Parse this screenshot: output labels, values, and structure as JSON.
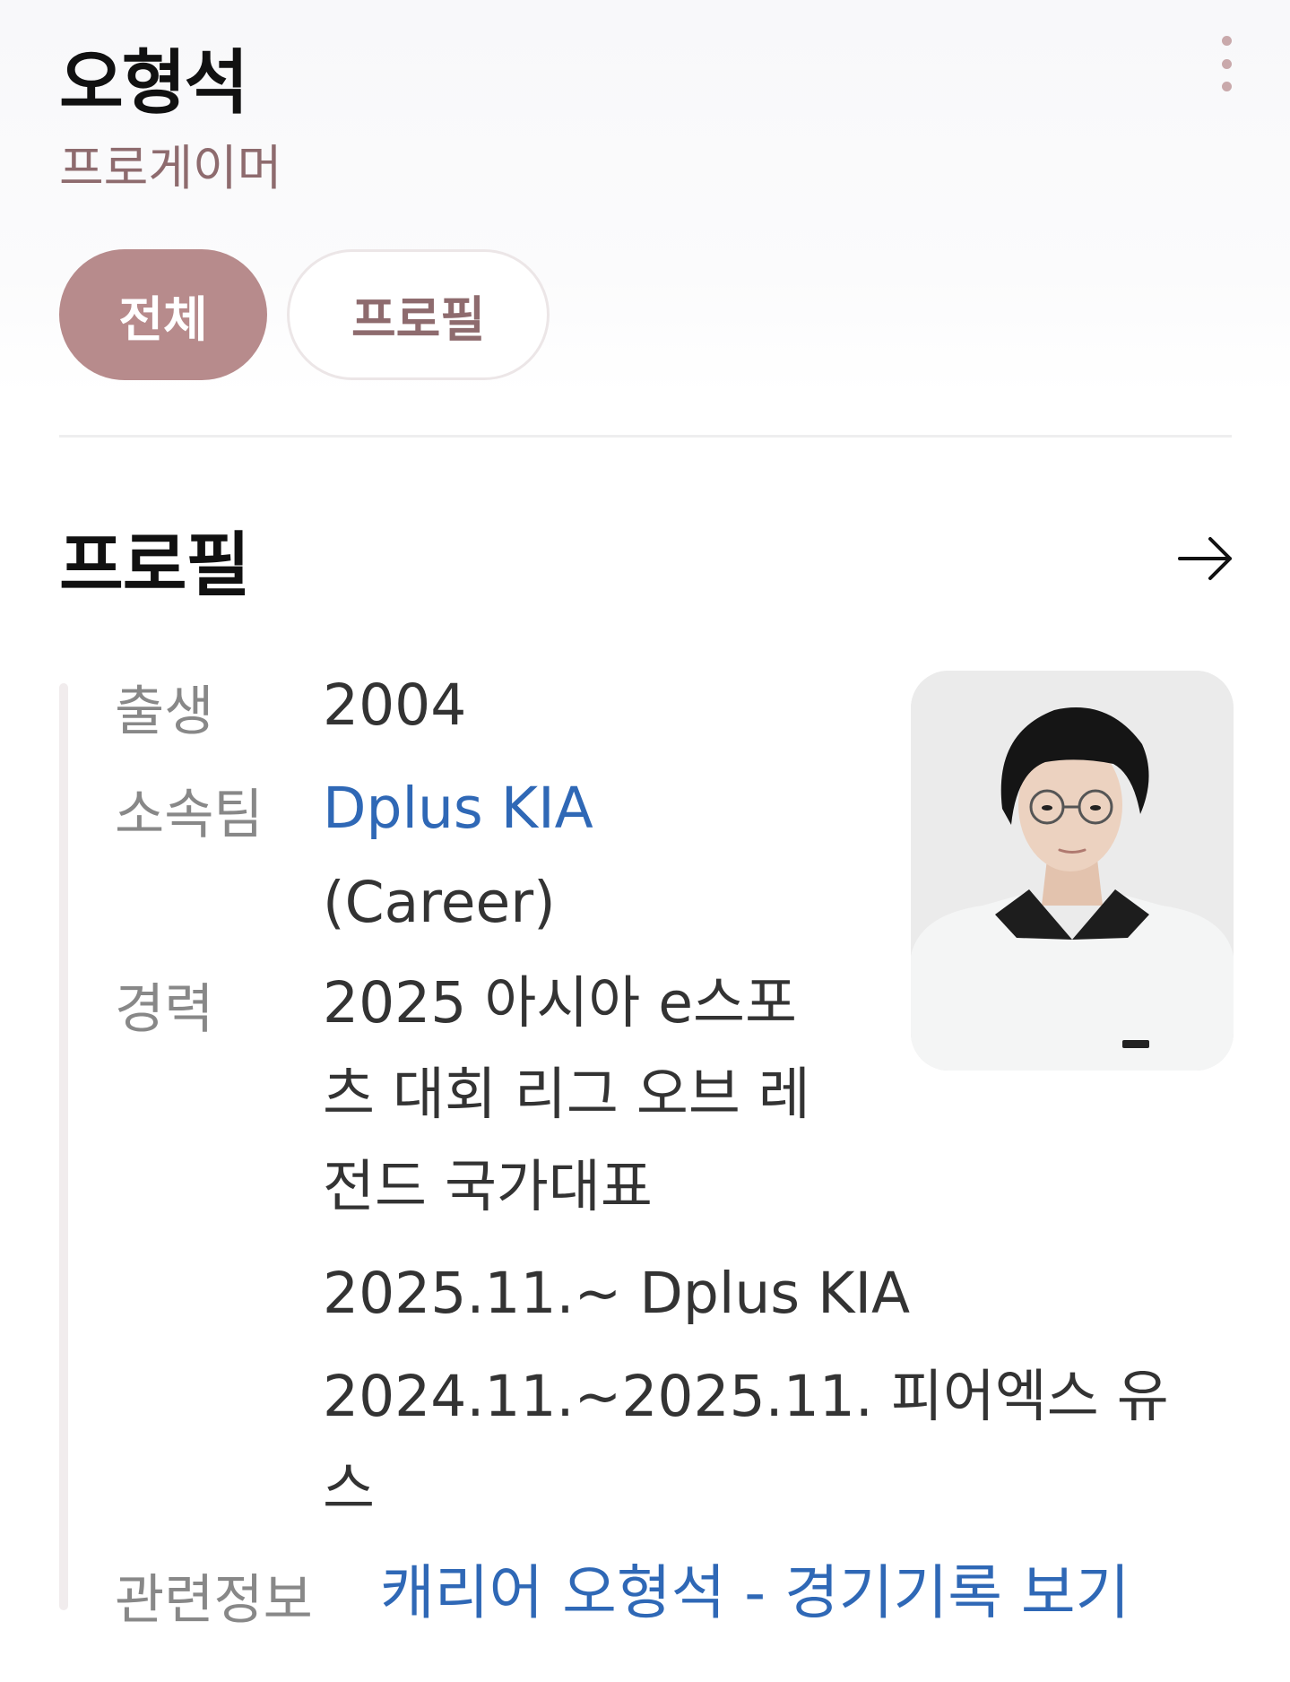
{
  "header": {
    "name": "오형석",
    "subtitle": "프로게이머",
    "more_icon": "more-vertical-icon"
  },
  "tabs": [
    {
      "label": "전체",
      "active": true
    },
    {
      "label": "프로필",
      "active": false
    }
  ],
  "colors": {
    "accent": "#b78b8c",
    "subtitle": "#8e6b6e",
    "link": "#2f68b6",
    "label": "#888888"
  },
  "profile": {
    "title": "프로필",
    "arrow_icon": "arrow-right-icon",
    "rows": {
      "birth": {
        "label": "출생",
        "value": "2004"
      },
      "team": {
        "label": "소속팀",
        "link": "Dplus KIA",
        "note": "(Career)"
      },
      "career": {
        "label": "경력",
        "items": [
          {
            "lines": [
              "2025 아시아 e스포",
              "츠 대회 리그 오브 레",
              "전드 국가대표"
            ]
          },
          {
            "lines": [
              "2025.11.~ Dplus KIA"
            ]
          },
          {
            "lines": [
              "2024.11.~2025.11. 피어엑스 유",
              "스"
            ]
          }
        ]
      },
      "related": {
        "label": "관련정보",
        "link": "캐리어 오형석 - 경기기록 보기"
      }
    }
  }
}
